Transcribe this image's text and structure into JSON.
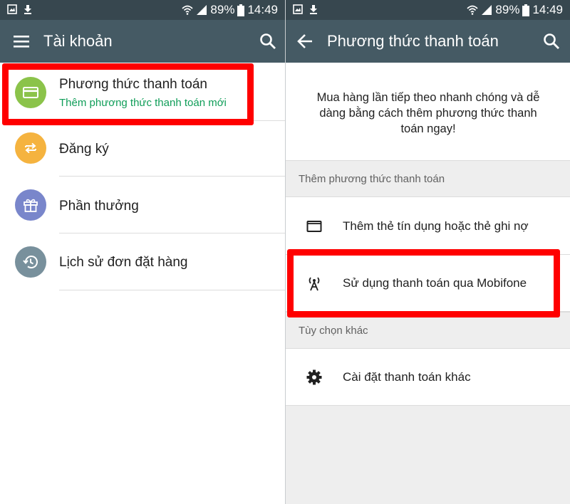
{
  "status": {
    "battery": "89%",
    "time": "14:49"
  },
  "left": {
    "title": "Tài khoản",
    "items": [
      {
        "label": "Phương thức thanh toán",
        "subtitle": "Thêm phương thức thanh toán mới",
        "icon": "credit-card-icon",
        "color": "#8bc34a"
      },
      {
        "label": "Đăng ký",
        "icon": "repeat-icon",
        "color": "#f5b33f"
      },
      {
        "label": "Phần thưởng",
        "icon": "gift-icon",
        "color": "#7986cb"
      },
      {
        "label": "Lịch sử đơn đặt hàng",
        "icon": "history-icon",
        "color": "#78909c"
      }
    ]
  },
  "right": {
    "title": "Phương thức thanh toán",
    "intro": "Mua hàng lần tiếp theo nhanh chóng và dễ dàng bằng cách thêm phương thức thanh toán ngay!",
    "section1": "Thêm phương thức thanh toán",
    "add_card": "Thêm thẻ tín dụng hoặc thẻ ghi nợ",
    "mobifone": "Sử dụng thanh toán qua Mobifone",
    "section2": "Tùy chọn khác",
    "other_settings": "Cài đặt thanh toán khác"
  },
  "colors": {
    "statusbar": "#37474f",
    "appbar": "#455a64",
    "highlight": "#ff0000",
    "subtitle_green": "#0f9d58"
  }
}
